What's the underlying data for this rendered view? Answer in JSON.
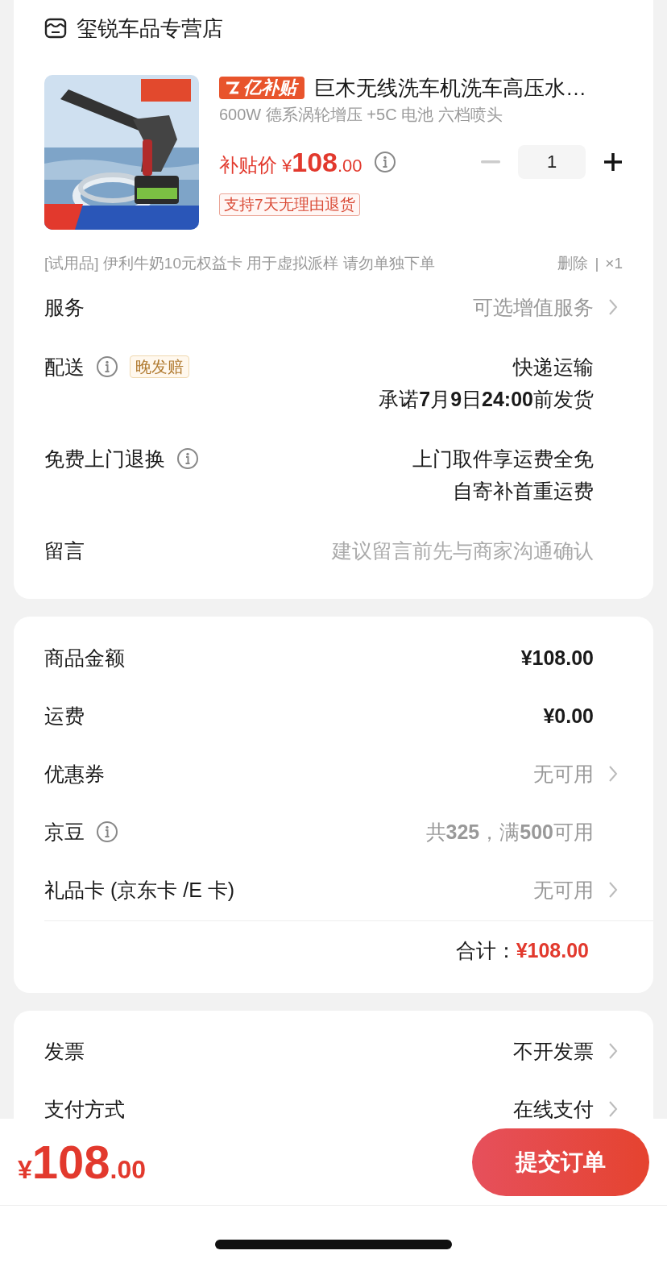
{
  "store": {
    "name": "玺锐车品专营店"
  },
  "product": {
    "badge": "亿补贴",
    "title": "巨木无线洗车机洗车高压水…",
    "spec": "600W 德系涡轮增压 +5C 电池 六档喷头",
    "price_label": "补贴价",
    "currency": "¥",
    "price_int": "108",
    "price_dec": ".00",
    "return_tag": "支持7天无理由退货",
    "quantity": "1",
    "minus_disabled": true
  },
  "trial_item": {
    "text": "[试用品] 伊利牛奶10元权益卡 用于虚拟派样 请勿单独下单",
    "delete": "删除",
    "separator": "|",
    "count": "×1"
  },
  "order_rows": [
    {
      "kind": "muted",
      "label": "服务",
      "info": false,
      "values": [
        "可选增值服务"
      ],
      "arrow": true
    },
    {
      "kind": "plain",
      "label": "配送",
      "info": true,
      "tag": "晚发赔",
      "values": [
        "快递运输",
        "承诺**7**月**9**日**24:00**前发货"
      ],
      "arrow": false
    },
    {
      "kind": "plain",
      "label": "免费上门退换",
      "info": true,
      "values": [
        "上门取件享运费全免",
        "自寄补首重运费"
      ],
      "arrow": false
    },
    {
      "kind": "field",
      "label": "留言",
      "info": false,
      "placeholder": "建议留言前先与商家沟通确认",
      "arrow": false
    }
  ],
  "summary_rows": [
    {
      "kind": "strong",
      "label": "商品金额",
      "info": false,
      "values": [
        "¥108.00"
      ],
      "arrow": false
    },
    {
      "kind": "strong",
      "label": "运费",
      "info": false,
      "values": [
        "¥0.00"
      ],
      "arrow": false
    },
    {
      "kind": "muted",
      "label": "优惠券",
      "info": false,
      "values": [
        "无可用"
      ],
      "arrow": true
    },
    {
      "kind": "muted",
      "label": "京豆",
      "info": true,
      "values": [
        "共**325**，满**500**可用"
      ],
      "arrow": false
    },
    {
      "kind": "muted",
      "label": "礼品卡 (京东卡 /E 卡)",
      "info": false,
      "values": [
        "无可用"
      ],
      "arrow": true
    }
  ],
  "total": {
    "label": "合计：",
    "value": "¥108.00"
  },
  "other_rows": [
    {
      "kind": "plain",
      "label": "发票",
      "info": false,
      "values": [
        "不开发票"
      ],
      "arrow": true
    },
    {
      "kind": "plain",
      "label": "支付方式",
      "info": false,
      "values": [
        "在线支付"
      ],
      "arrow": true
    }
  ],
  "footer": {
    "currency": "¥",
    "price_int": "108",
    "price_dec": ".00",
    "submit": "提交订单"
  }
}
